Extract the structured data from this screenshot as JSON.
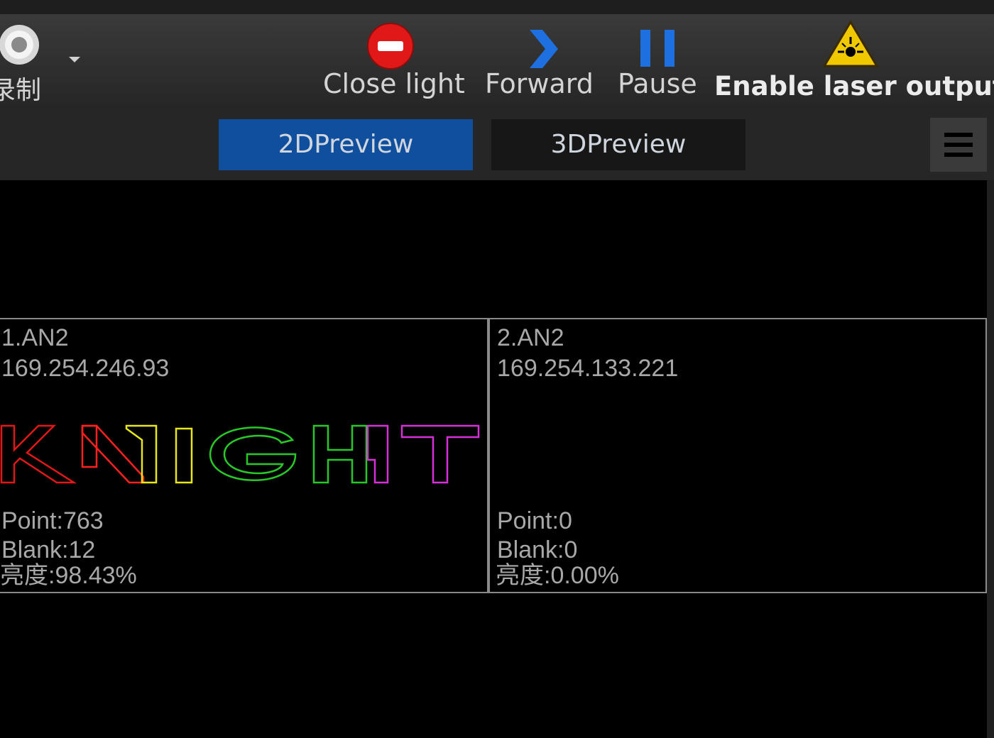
{
  "toolbar": {
    "record": {
      "label": "录制"
    },
    "close_light": {
      "label": "Close light",
      "icon": "no-entry-icon"
    },
    "forward": {
      "label": "Forward",
      "icon": "chevron-right-icon"
    },
    "pause": {
      "label": "Pause",
      "icon": "pause-icon"
    },
    "enable_laser": {
      "label": "Enable laser output",
      "icon": "laser-warning-icon"
    }
  },
  "tabs": {
    "preview_2d": "2DPreview",
    "preview_3d": "3DPreview"
  },
  "devices": [
    {
      "name": "1.AN2",
      "ip": "169.254.246.93",
      "point": "Point:763",
      "blank": "Blank:12",
      "brightness": "亮度:98.43%",
      "preview_text": "KNIGHT"
    },
    {
      "name": "2.AN2",
      "ip": "169.254.133.221",
      "point": "Point:0",
      "blank": "Blank:0",
      "brightness": "亮度:0.00%"
    }
  ],
  "colors": {
    "accent": "#0f4f9e",
    "laser_red": "#e01818",
    "laser_yellow": "#e8e818",
    "laser_green": "#28c828",
    "laser_magenta": "#d830d8"
  }
}
